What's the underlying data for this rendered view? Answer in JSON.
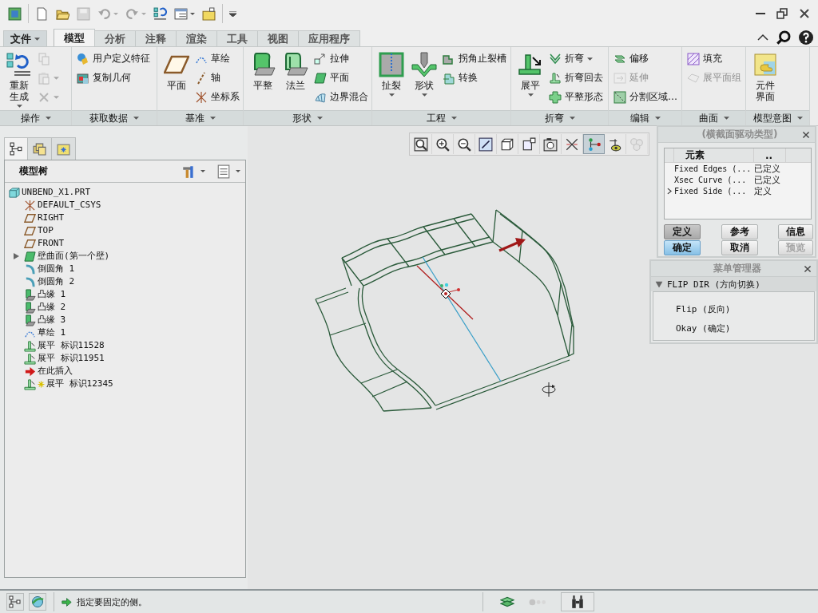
{
  "quick_access": [
    {
      "disabled": false
    },
    {
      "disabled": false
    },
    {
      "disabled": false
    },
    {
      "disabled": true
    },
    {
      "disabled": true
    },
    {
      "disabled": true
    },
    {
      "disabled": false
    },
    {
      "disabled": false
    },
    {
      "disabled": false
    }
  ],
  "ribbon_tabs": [
    {
      "label": "文件",
      "kind": "menu",
      "selected": false
    },
    {
      "label": "模型",
      "kind": "tab",
      "selected": true
    },
    {
      "label": "分析",
      "kind": "tab",
      "selected": false
    },
    {
      "label": "注释",
      "kind": "tab",
      "selected": false
    },
    {
      "label": "渲染",
      "kind": "tab",
      "selected": false
    },
    {
      "label": "工具",
      "kind": "tab",
      "selected": false
    },
    {
      "label": "视图",
      "kind": "tab",
      "selected": false
    },
    {
      "label": "应用程序",
      "kind": "tab",
      "selected": false
    }
  ],
  "ribbon_groups": [
    {
      "label": "操作",
      "items": [
        {
          "label": "重新生成",
          "kind": "large",
          "dropdown": true,
          "disabled": false
        },
        {
          "kind": "small",
          "dropdown": false,
          "disabled": true
        },
        {
          "kind": "small",
          "dropdown": true,
          "disabled": true
        },
        {
          "kind": "small",
          "dropdown": true,
          "disabled": true
        }
      ]
    },
    {
      "label": "获取数据",
      "items": [
        {
          "label": "用户定义特征",
          "kind": "small",
          "dropdown": false,
          "disabled": false
        },
        {
          "label": "复制几何",
          "kind": "small",
          "dropdown": false,
          "disabled": false
        }
      ]
    },
    {
      "label": "基准",
      "items": [
        {
          "label": "平面",
          "kind": "large",
          "dropdown": false,
          "disabled": false
        },
        {
          "label": "草绘",
          "kind": "small",
          "dropdown": false,
          "disabled": false
        },
        {
          "label": "轴",
          "kind": "small",
          "dropdown": false,
          "disabled": false
        },
        {
          "label": "坐标系",
          "kind": "small",
          "dropdown": false,
          "disabled": false
        }
      ]
    },
    {
      "label": "形状",
      "items": [
        {
          "label": "平整",
          "kind": "large",
          "dropdown": false,
          "disabled": false
        },
        {
          "label": "法兰",
          "kind": "large",
          "dropdown": false,
          "disabled": false
        },
        {
          "label": "拉伸",
          "kind": "small",
          "dropdown": false,
          "disabled": false
        },
        {
          "label": "平面",
          "kind": "small",
          "dropdown": false,
          "disabled": false
        },
        {
          "label": "边界混合",
          "kind": "small",
          "dropdown": false,
          "disabled": false
        }
      ]
    },
    {
      "label": "工程",
      "items": [
        {
          "label": "扯裂",
          "kind": "large",
          "dropdown": true,
          "disabled": false
        },
        {
          "label": "形状",
          "kind": "large",
          "dropdown": true,
          "disabled": false
        },
        {
          "label": "拐角止裂槽",
          "kind": "small",
          "dropdown": false,
          "disabled": false
        },
        {
          "label": "转换",
          "kind": "small",
          "dropdown": false,
          "disabled": false
        }
      ]
    },
    {
      "label": "折弯",
      "items": [
        {
          "label": "展平",
          "kind": "large",
          "dropdown": true,
          "disabled": false
        },
        {
          "label": "折弯",
          "kind": "small",
          "dropdown": true,
          "disabled": false
        },
        {
          "label": "折弯回去",
          "kind": "small",
          "dropdown": false,
          "disabled": false
        },
        {
          "label": "平整形态",
          "kind": "small",
          "dropdown": false,
          "disabled": false
        }
      ]
    },
    {
      "label": "编辑",
      "items": [
        {
          "label": "偏移",
          "kind": "small",
          "dropdown": false,
          "disabled": false
        },
        {
          "label": "延伸",
          "kind": "small",
          "dropdown": false,
          "disabled": true
        },
        {
          "label": "分割区域…",
          "kind": "small",
          "dropdown": false,
          "disabled": false
        }
      ]
    },
    {
      "label": "曲面",
      "items": [
        {
          "label": "填充",
          "kind": "small",
          "dropdown": false,
          "disabled": false
        },
        {
          "label": "展平面组",
          "kind": "small",
          "dropdown": false,
          "disabled": true
        }
      ]
    },
    {
      "label": "模型意图",
      "items": [
        {
          "label": "元件界面",
          "kind": "large",
          "dropdown": false,
          "disabled": false
        }
      ]
    }
  ],
  "model_tree": {
    "tabs": [
      {
        "selected": true
      },
      {
        "selected": false
      },
      {
        "selected": false
      }
    ],
    "title": "模型树",
    "items": [
      {
        "label": "UNBEND_X1.PRT",
        "kind": "part",
        "children": [
          {
            "label": "DEFAULT_CSYS",
            "kind": "csys"
          },
          {
            "label": "RIGHT",
            "kind": "plane"
          },
          {
            "label": "TOP",
            "kind": "plane"
          },
          {
            "label": "FRONT",
            "kind": "plane"
          },
          {
            "label": "壁曲面(第一个壁)",
            "kind": "wall",
            "expanded": false
          },
          {
            "label": "倒圆角 1",
            "kind": "round"
          },
          {
            "label": "倒圆角 2",
            "kind": "round"
          },
          {
            "label": "凸缘 1",
            "kind": "flange"
          },
          {
            "label": "凸缘 2",
            "kind": "flange"
          },
          {
            "label": "凸缘 3",
            "kind": "flange"
          },
          {
            "label": "草绘 1",
            "kind": "sketch"
          },
          {
            "label": "展平 标识11528",
            "kind": "unbend"
          },
          {
            "label": "展平 标识11951",
            "kind": "unbend"
          },
          {
            "label": "在此插入",
            "kind": "insert"
          },
          {
            "label": "展平 标识12345",
            "kind": "unbend_new"
          }
        ]
      }
    ]
  },
  "view_toolbar": [
    {
      "on": false,
      "disabled": false
    },
    {
      "on": false,
      "disabled": false
    },
    {
      "on": false,
      "disabled": false
    },
    {
      "on": false,
      "disabled": false
    },
    {
      "on": false,
      "disabled": false
    },
    {
      "on": false,
      "disabled": false
    },
    {
      "on": false,
      "disabled": false
    },
    {
      "on": false,
      "disabled": false
    },
    {
      "on": true,
      "disabled": false
    },
    {
      "on": false,
      "disabled": false
    },
    {
      "on": false,
      "disabled": true
    }
  ],
  "feature_dialog": {
    "title": "(横截面驱动类型)",
    "columns": [
      "元素",
      ".."
    ],
    "rows": [
      {
        "element": "Fixed Edges (...",
        "info": "已定义",
        "current": false
      },
      {
        "element": "Xsec Curve (...",
        "info": "已定义",
        "current": false
      },
      {
        "element": "Fixed Side (...",
        "info": "定义",
        "current": true
      }
    ],
    "buttons": [
      {
        "label": "定义",
        "pressed": true,
        "default": false,
        "disabled": false
      },
      {
        "label": "参考",
        "pressed": false,
        "default": false,
        "disabled": false
      },
      {
        "label": "信息",
        "pressed": false,
        "default": false,
        "disabled": false
      },
      {
        "label": "确定",
        "pressed": false,
        "default": true,
        "disabled": false
      },
      {
        "label": "取消",
        "pressed": false,
        "default": false,
        "disabled": false
      },
      {
        "label": "预览",
        "pressed": false,
        "default": false,
        "disabled": true
      }
    ]
  },
  "menu_manager": {
    "title": "菜单管理器",
    "menu": {
      "label": "FLIP DIR (方向切换)",
      "expanded": true,
      "items": [
        "Flip (反向)",
        "Okay (确定)"
      ]
    }
  },
  "status_bar": {
    "message": "指定要固定的侧。"
  }
}
